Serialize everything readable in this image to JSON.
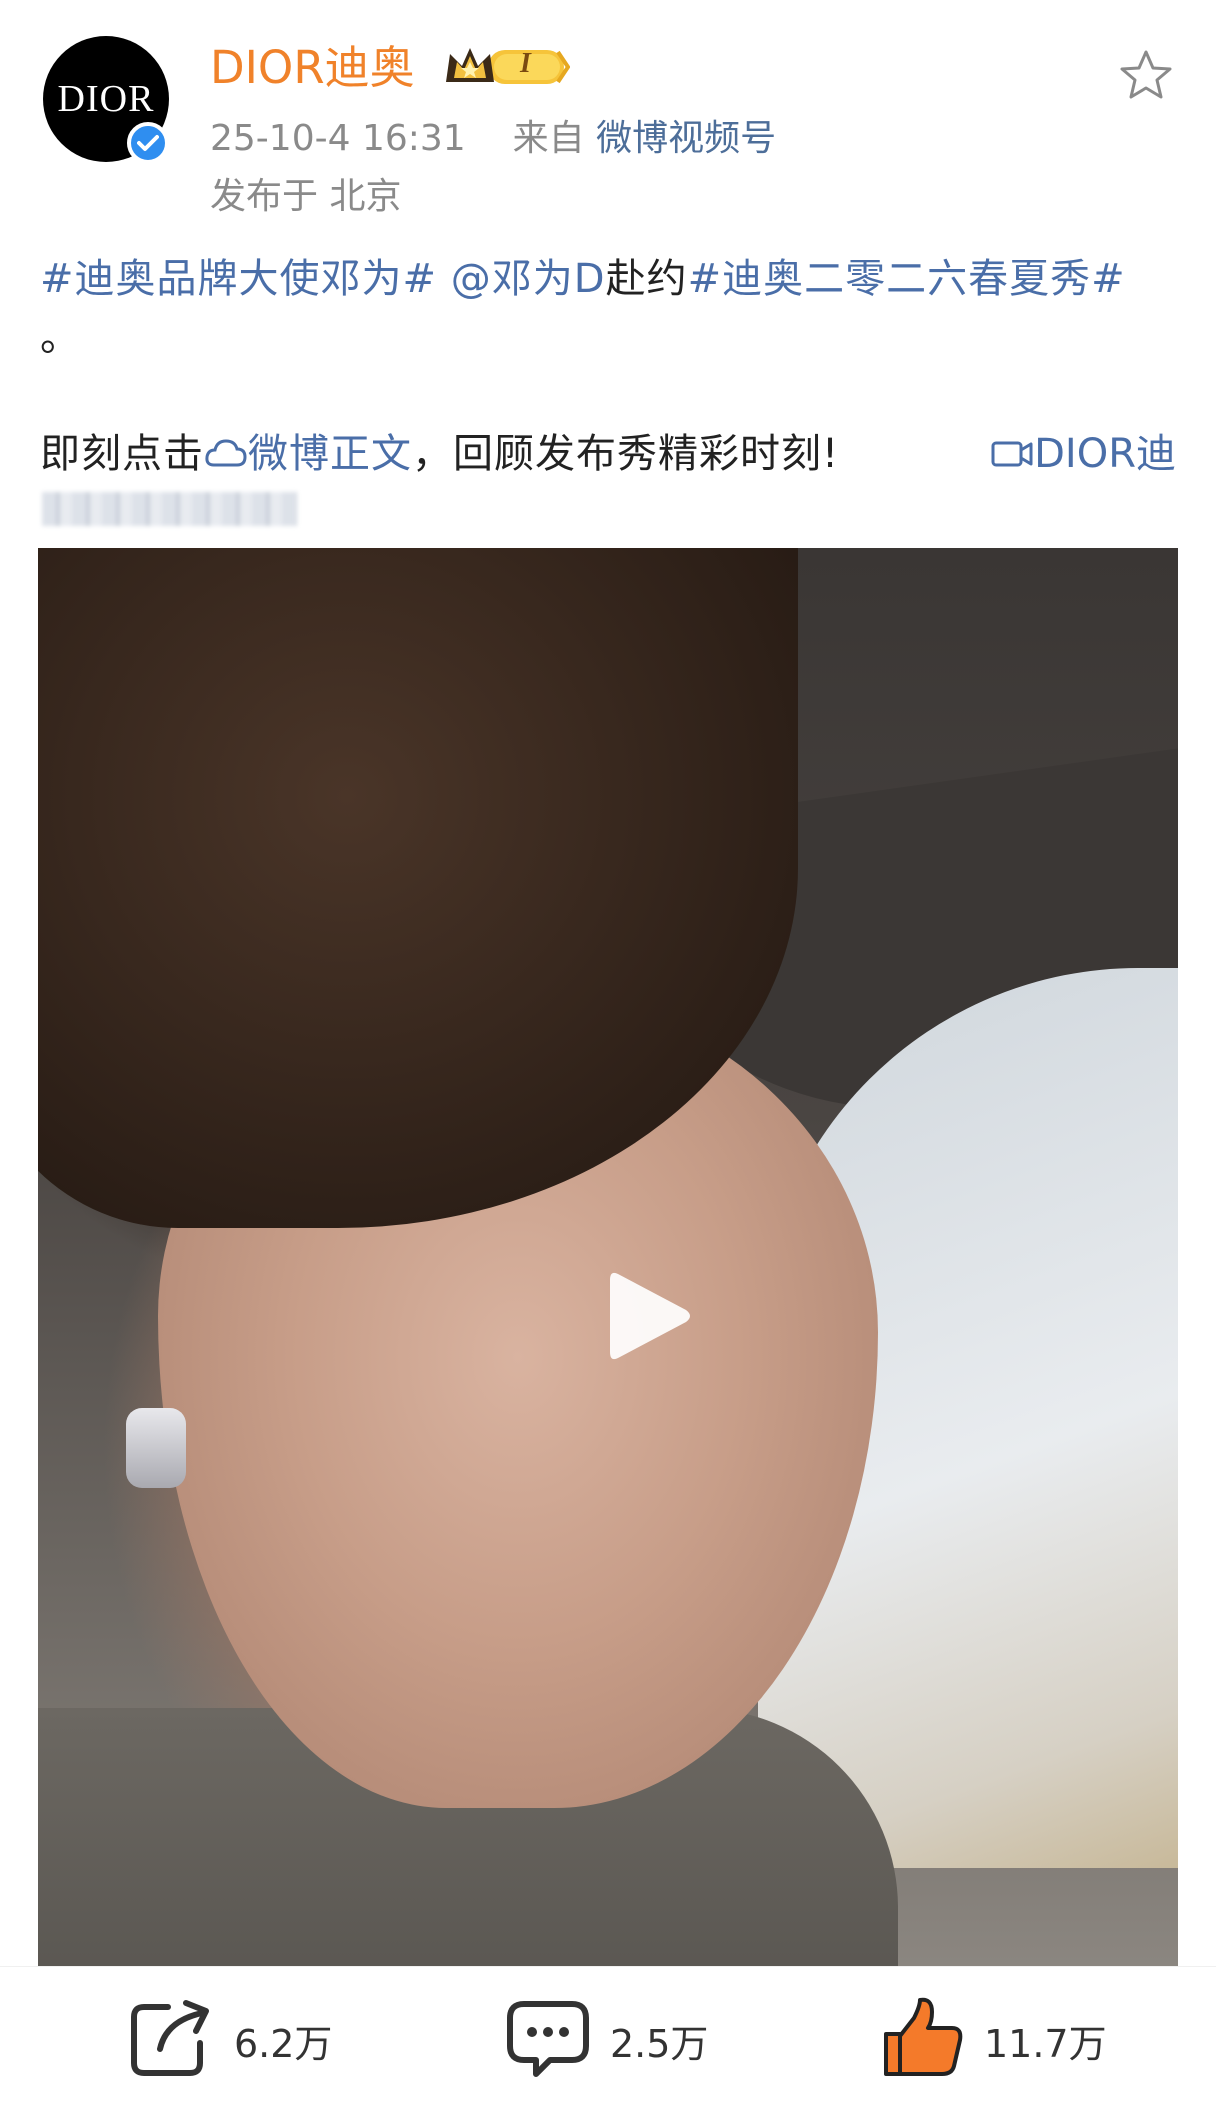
{
  "header": {
    "avatar_text": "DIOR",
    "username": "DIOR迪奥",
    "level_badge": "I",
    "timestamp": "25-10-4 16:31",
    "source_prefix": "来自",
    "source": "微博视频号",
    "location": "发布于 北京"
  },
  "post": {
    "tag1": "#迪奥品牌大使邓为#",
    "mention": "@邓为D",
    "text1": "赴约",
    "tag2": "#迪奥二零二六春夏秀#",
    "text2": "。",
    "line2_prefix": "即刻点击",
    "line2_link": "微博正文",
    "line2_suffix": "，回顾发布秀精彩时刻!",
    "video_link": "DIOR迪"
  },
  "actions": {
    "share_count": "6.2万",
    "comment_count": "2.5万",
    "like_count": "11.7万"
  },
  "colors": {
    "username": "#f0822a",
    "link": "#4a6ea8",
    "meta": "#8a8a8a",
    "verify": "#2f8ef0",
    "like": "#f47a2a"
  },
  "icons": [
    "star-icon",
    "verified-icon",
    "crown-badge-icon",
    "cloud-icon",
    "video-icon",
    "play-icon",
    "share-icon",
    "comment-icon",
    "like-icon"
  ]
}
